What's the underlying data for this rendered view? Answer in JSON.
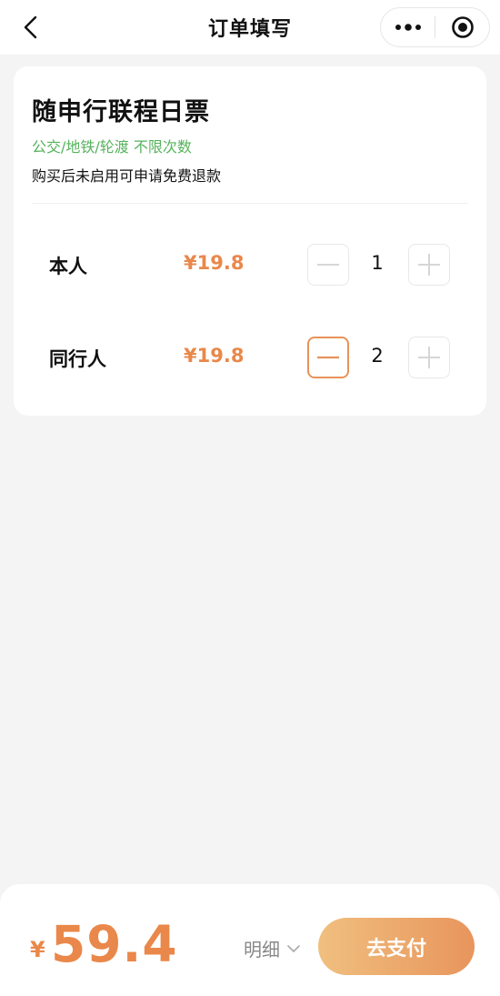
{
  "header": {
    "title": "订单填写",
    "back_icon": "chevron-left-icon",
    "more_icon": "more-dots-icon",
    "close_icon": "target-circle-icon"
  },
  "ticket": {
    "title": "随申行联程日票",
    "modes": "公交/地铁/轮渡 不限次数",
    "refund_note": "购买后未启用可申请免费退款"
  },
  "passengers": [
    {
      "label": "本人",
      "price": "¥19.8",
      "quantity": "1",
      "minus_active": false
    },
    {
      "label": "同行人",
      "price": "¥19.8",
      "quantity": "2",
      "minus_active": true
    }
  ],
  "footer": {
    "currency": "¥",
    "total": "59.4",
    "detail_label": "明细",
    "pay_label": "去支付"
  },
  "colors": {
    "accent": "#e9884a",
    "green": "#55b25c",
    "pay_gradient_start": "#f0bf7f",
    "pay_gradient_end": "#e8955c"
  }
}
